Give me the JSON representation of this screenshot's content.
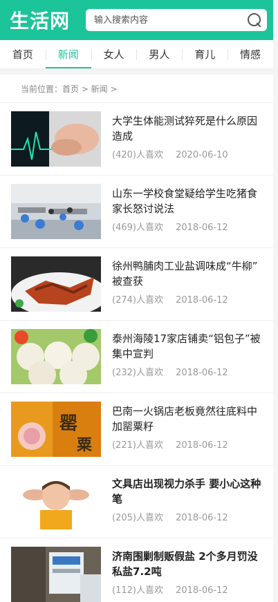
{
  "header": {
    "logo": "生活网",
    "search_placeholder": "输入搜索内容"
  },
  "nav": {
    "items": [
      "首页",
      "新闻",
      "女人",
      "男人",
      "育儿",
      "情感"
    ],
    "active": "新闻"
  },
  "breadcrumb": "当前位置：首页 > 新闻 >",
  "articles": [
    {
      "title": "大学生体能测试猝死是什么原因造成",
      "likes": "(420)人喜欢",
      "date": "2020-06-10"
    },
    {
      "title": "山东一学校食堂疑给学生吃猪食 家长怒讨说法",
      "likes": "(469)人喜欢",
      "date": "2018-06-12"
    },
    {
      "title": "徐州鸭脯肉工业盐调味成“牛柳” 被查获",
      "likes": "(274)人喜欢",
      "date": "2018-06-12"
    },
    {
      "title": "泰州海陵17家店铺卖“铝包子”被集中宣判",
      "likes": "(232)人喜欢",
      "date": "2018-06-12"
    },
    {
      "title": "巴南一火锅店老板竟然往底料中加罂粟籽",
      "likes": "(221)人喜欢",
      "date": "2018-06-12"
    },
    {
      "title": "文具店出现视力杀手 要小心这种笔",
      "likes": "(205)人喜欢",
      "date": "2018-06-12"
    },
    {
      "title": "济南围剿制贩假盐 2个多月罚没私盐7.2吨",
      "likes": "(112)人喜欢",
      "date": "2018-06-12"
    }
  ]
}
